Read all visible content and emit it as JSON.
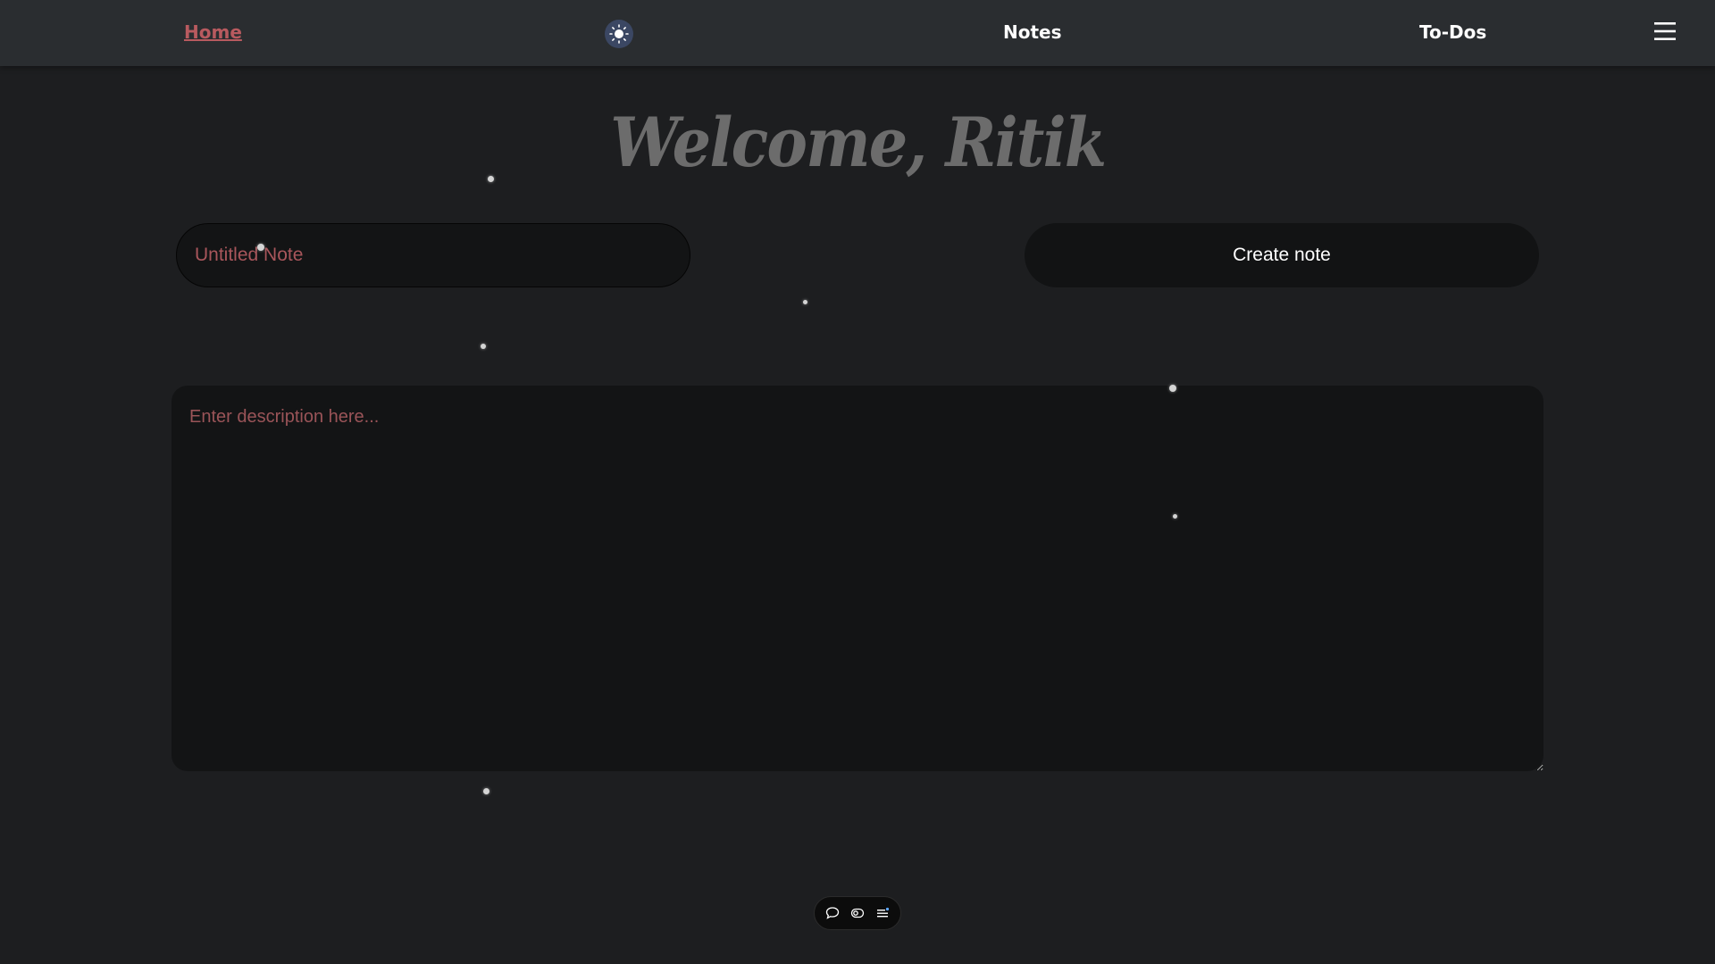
{
  "nav": {
    "home_label": "Home",
    "notes_label": "Notes",
    "todos_label": "To-Dos",
    "theme_icon": "sun-icon",
    "menu_icon": "hamburger-menu-icon"
  },
  "welcome": {
    "text": "Welcome, Ritik"
  },
  "note_form": {
    "title_placeholder": "Untitled Note",
    "title_value": "",
    "create_label": "Create note",
    "description_placeholder": "Enter description here...",
    "description_value": ""
  },
  "toolbar": {
    "icons": [
      "chat-bubble-icon",
      "toggle-icon",
      "list-icon"
    ]
  },
  "colors": {
    "background": "#1d1e20",
    "navbar": "#2a2d30",
    "accent_link": "#b85a5f",
    "placeholder": "#a8565b",
    "field_background": "#131415",
    "welcome_text": "#6c6c6c"
  }
}
